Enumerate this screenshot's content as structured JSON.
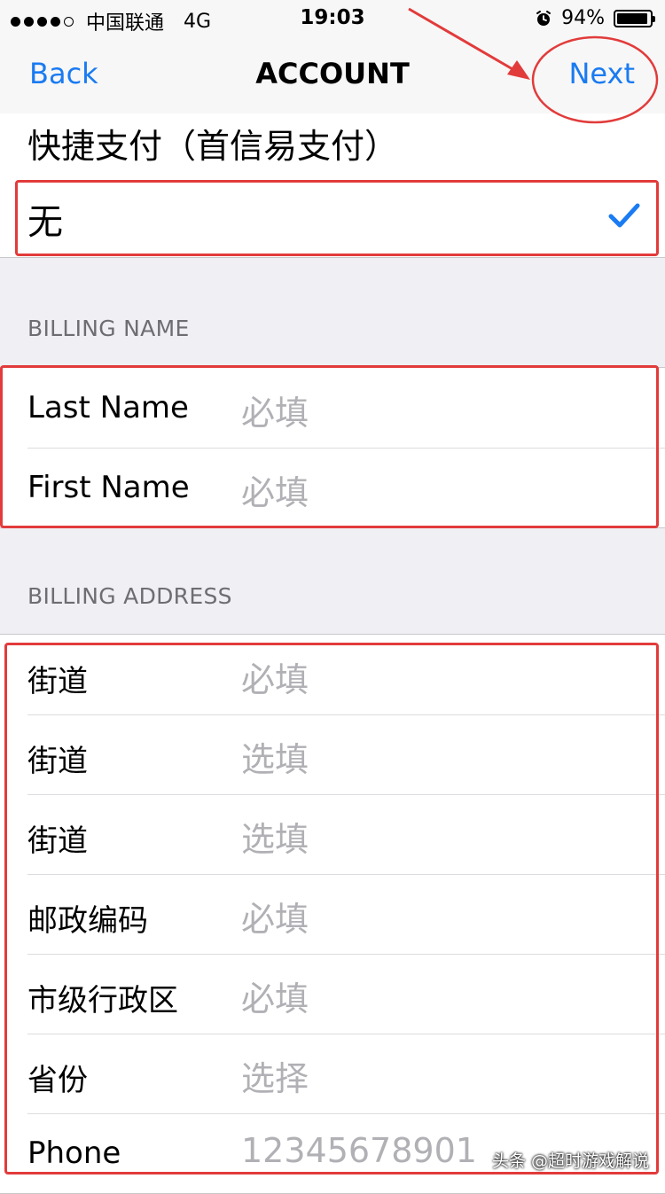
{
  "status_bar": {
    "carrier": "中国联通",
    "network": "4G",
    "time": "19:03",
    "battery": "94%",
    "battery_level": 0.94
  },
  "nav": {
    "back_label": "Back",
    "title": "ACCOUNT",
    "next_label": "Next"
  },
  "payment": {
    "heading": "快捷支付（首信易支付）",
    "selected_option": "无"
  },
  "billing_name": {
    "header": "BILLING NAME",
    "rows": [
      {
        "label": "Last Name",
        "placeholder": "必填"
      },
      {
        "label": "First Name",
        "placeholder": "必填"
      }
    ]
  },
  "billing_address": {
    "header": "BILLING ADDRESS",
    "rows": [
      {
        "label": "街道",
        "placeholder": "必填"
      },
      {
        "label": "街道",
        "placeholder": "选填"
      },
      {
        "label": "街道",
        "placeholder": "选填"
      },
      {
        "label": "邮政编码",
        "placeholder": "必填"
      },
      {
        "label": "市级行政区",
        "placeholder": "必填"
      },
      {
        "label": "省份",
        "placeholder": "选择"
      },
      {
        "label": "Phone",
        "placeholder": "12345678901"
      }
    ]
  },
  "watermark": "头条 @超时游戏解说",
  "colors": {
    "accent": "#1a7bf2",
    "annotation": "#e23b3b",
    "placeholder": "#b0b0b5",
    "background": "#efeff4"
  }
}
